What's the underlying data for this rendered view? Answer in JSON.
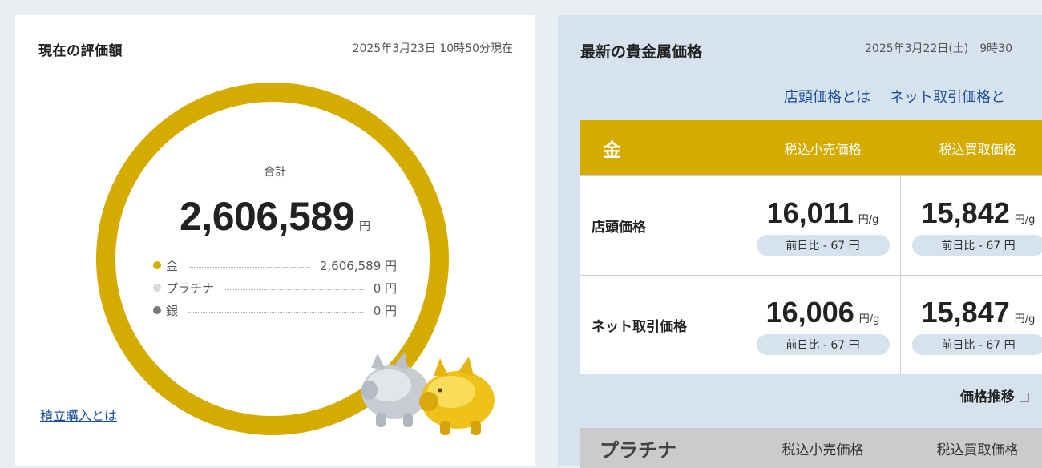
{
  "valuation": {
    "title": "現在の評価額",
    "as_of": "2025年3月23日 10時50分現在",
    "total_label": "合計",
    "total_value": "2,606,589",
    "total_unit": "円",
    "breakdown": [
      {
        "label": "金",
        "value": "2,606,589 円",
        "color": "#d6ab00"
      },
      {
        "label": "プラチナ",
        "value": "0 円",
        "color": "#dadada"
      },
      {
        "label": "銀",
        "value": "0 円",
        "color": "#777777"
      }
    ],
    "accumulation_link": "積立購入とは"
  },
  "prices": {
    "title": "最新の貴金属価格",
    "as_of": "2025年3月22日(土)　9時30",
    "links": [
      "店頭価格とは",
      "ネット取引価格と"
    ],
    "gold": {
      "metal": "金",
      "columns": [
        "税込小売価格",
        "税込買取価格"
      ],
      "rows": [
        {
          "label": "店頭価格",
          "cells": [
            {
              "price": "16,011",
              "unit": "円/g",
              "diff": "前日比 - 67 円"
            },
            {
              "price": "15,842",
              "unit": "円/g",
              "diff": "前日比 - 67 円"
            }
          ]
        },
        {
          "label": "ネット取引価格",
          "cells": [
            {
              "price": "16,006",
              "unit": "円/g",
              "diff": "前日比 - 67 円"
            },
            {
              "price": "15,847",
              "unit": "円/g",
              "diff": "前日比 - 67 円"
            }
          ]
        }
      ]
    },
    "trend_link": "価格推移",
    "platinum": {
      "metal": "プラチナ",
      "columns": [
        "税込小売価格",
        "税込買取価格"
      ]
    }
  }
}
